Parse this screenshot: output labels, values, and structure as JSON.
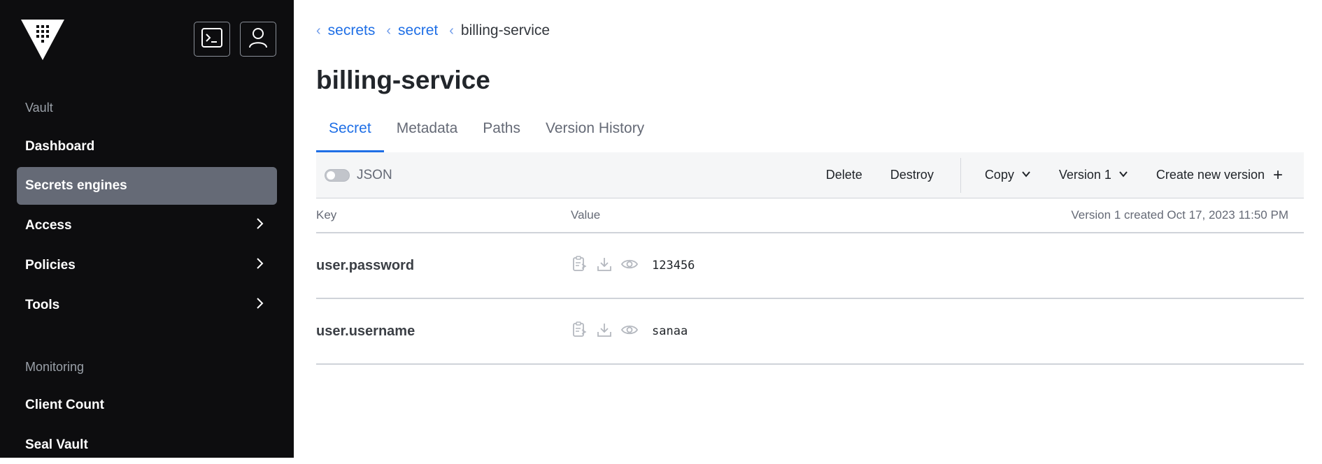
{
  "sidebar": {
    "sections": [
      {
        "label": "Vault"
      },
      {
        "label": "Monitoring"
      }
    ],
    "items": [
      {
        "label": "Dashboard"
      },
      {
        "label": "Secrets engines"
      },
      {
        "label": "Access"
      },
      {
        "label": "Policies"
      },
      {
        "label": "Tools"
      },
      {
        "label": "Client Count"
      },
      {
        "label": "Seal Vault"
      }
    ],
    "active_item": "Secrets engines"
  },
  "breadcrumb": [
    {
      "label": "secrets"
    },
    {
      "label": "secret"
    },
    {
      "label": "billing-service"
    }
  ],
  "page": {
    "title": "billing-service"
  },
  "tabs": [
    {
      "label": "Secret"
    },
    {
      "label": "Metadata"
    },
    {
      "label": "Paths"
    },
    {
      "label": "Version History"
    }
  ],
  "active_tab": "Secret",
  "toolbar": {
    "json_label": "JSON",
    "json_enabled": false,
    "delete_label": "Delete",
    "destroy_label": "Destroy",
    "copy_label": "Copy",
    "version_label": "Version 1",
    "create_label": "Create new version"
  },
  "table": {
    "headers": {
      "key": "Key",
      "value": "Value"
    },
    "meta": "Version 1 created Oct 17, 2023 11:50 PM",
    "rows": [
      {
        "key": "user.password",
        "value": "123456"
      },
      {
        "key": "user.username",
        "value": "sanaa"
      }
    ]
  },
  "colors": {
    "accent": "#1f6fe6",
    "sidebar_bg": "#0d0d0f",
    "sidebar_active": "#656a76"
  }
}
